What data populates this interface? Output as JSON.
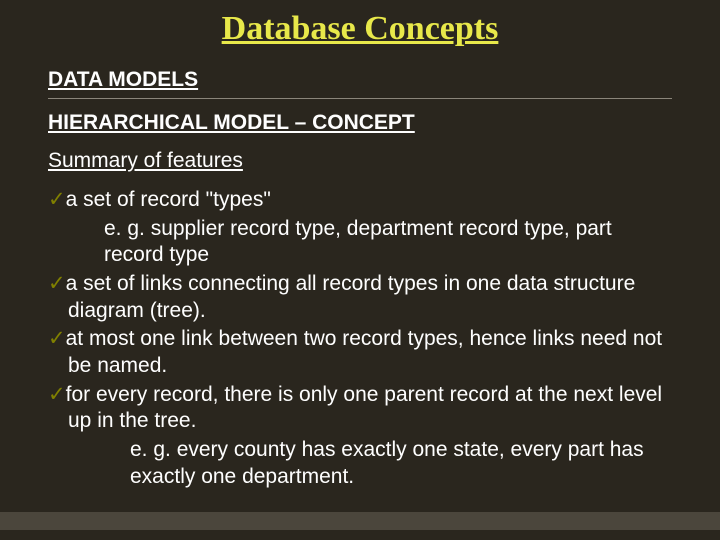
{
  "title": "Database Concepts",
  "section": "DATA MODELS",
  "subsection": "HIERARCHICAL MODEL – CONCEPT",
  "subheading": "Summary of features",
  "bullets": {
    "b1": "a set of record \"types\"",
    "b1_eg": "e. g. supplier record type, department record type, part record type",
    "b2": "a set of links connecting all record types in one data structure diagram (tree).",
    "b3": "at most one link between two record types, hence links need not be named.",
    "b4": "for every record, there is only one parent record at the next level up in the tree.",
    "b4_eg": "e. g. every county has exactly one state, every part has exactly one department."
  },
  "check": "✓"
}
